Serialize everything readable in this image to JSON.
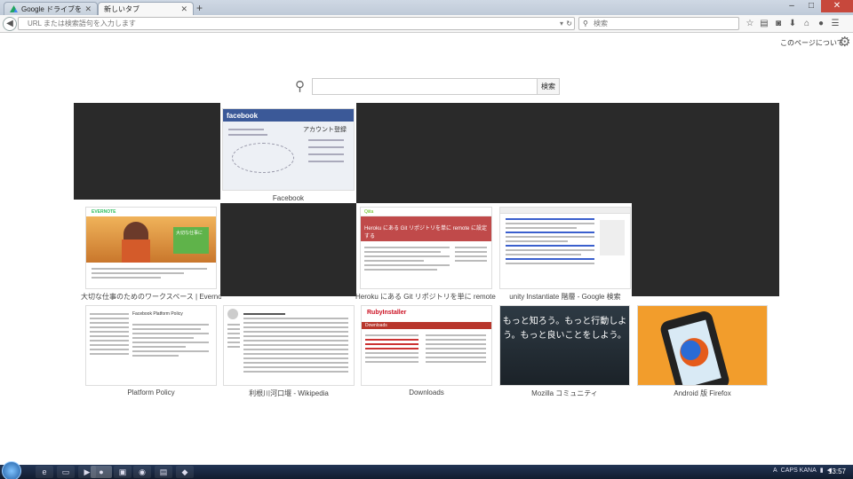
{
  "tabs": [
    {
      "label": "Google ドライブを活用 -...",
      "icon": "google-drive-icon",
      "active": false
    },
    {
      "label": "新しいタブ",
      "active": true
    }
  ],
  "window": {
    "minimize": "–",
    "maximize": "□",
    "close": "✕"
  },
  "navbar": {
    "url_placeholder": "URL または検索語句を入力します",
    "search_placeholder": "検索"
  },
  "page": {
    "about_link": "このページについて",
    "search_button": "検索"
  },
  "tiles": [
    {
      "title": "Facebook",
      "brand": "facebook",
      "signup": "アカウント登録"
    },
    {
      "title": "大切な仕事のためのワークスペース | Evernote",
      "brand": "EVERNOTE",
      "headline": "大切な仕事に"
    },
    {
      "title": "Heroku にある Git リポジトリを単に remote に設定...",
      "banner": "Heroku にある Git リポジトリを単に remote に設定する",
      "brand": "Qiita"
    },
    {
      "title": "unity Instantiate 階層 - Google 検索"
    },
    {
      "title": "Platform Policy",
      "heading": "Facebook Platform Policy"
    },
    {
      "title": "利根川河口堰 - Wikipedia"
    },
    {
      "title": "Downloads",
      "brand": "RubyInstaller",
      "band": "Downloads"
    },
    {
      "title": "Mozilla コミュニティ",
      "text": "もっと知ろう。もっと行動しよう。もっと良いことをしよう。"
    },
    {
      "title": "Android 版 Firefox"
    }
  ],
  "taskbar": {
    "clock": "13:57",
    "ime": "CAPS KANA",
    "lang": "A"
  }
}
